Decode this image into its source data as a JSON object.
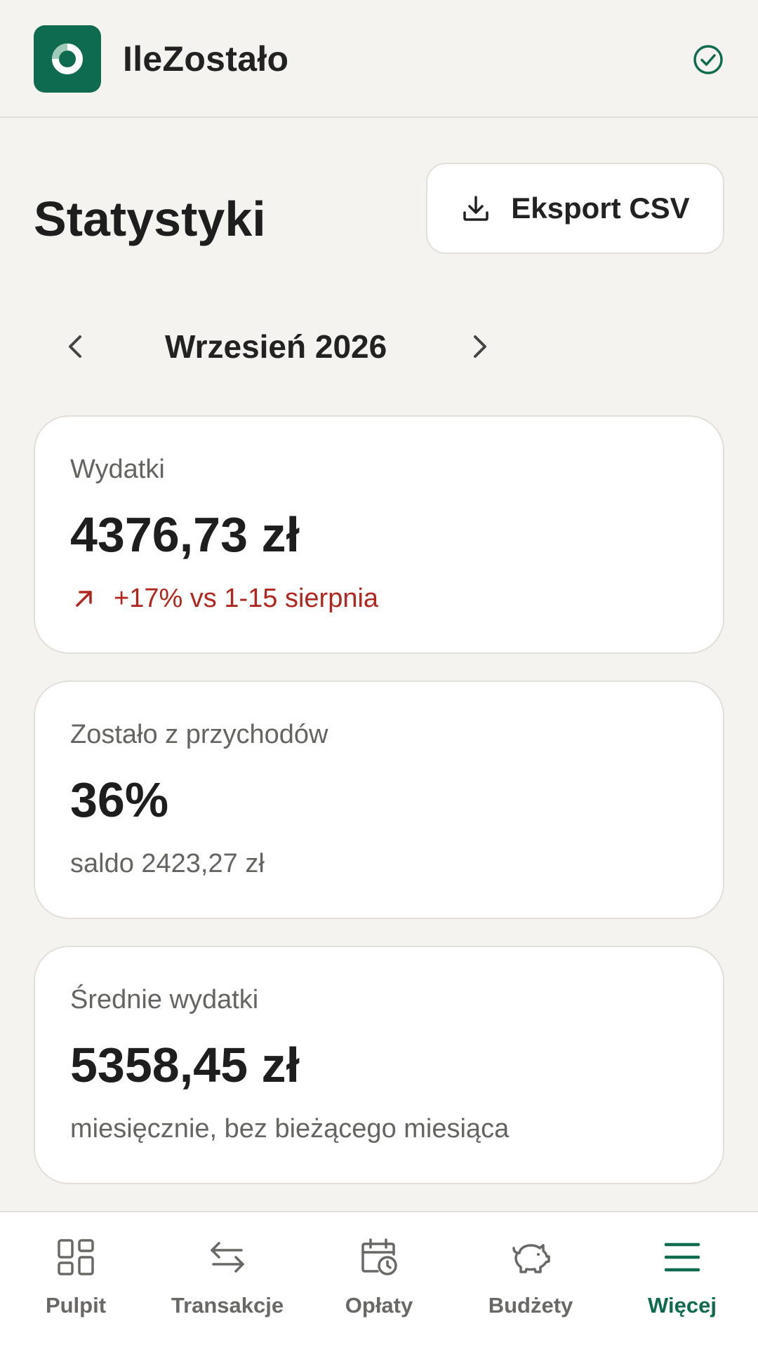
{
  "colors": {
    "background": "#f5f3ef",
    "brand": "#0f6b4f",
    "negative_trend": "#b3261e",
    "muted_text": "#666460"
  },
  "header": {
    "app_name": "IleZostało",
    "logo_icon": "ring-logo-icon",
    "status_icon": "check-circle-icon"
  },
  "page": {
    "title": "Statystyki",
    "export_button": {
      "label": "Eksport CSV",
      "icon": "download-icon"
    }
  },
  "month_nav": {
    "label": "Wrzesień 2026",
    "prev_icon": "chevron-left-icon",
    "next_icon": "chevron-right-icon"
  },
  "cards": [
    {
      "label": "Wydatki",
      "value": "4376,73 zł",
      "trend": "+17% vs 1-15 sierpnia",
      "trend_icon": "arrow-up-right-icon"
    },
    {
      "label": "Zostało z przychodów",
      "value": "36%",
      "sub": "saldo 2423,27 zł"
    },
    {
      "label": "Średnie wydatki",
      "value": "5358,45 zł",
      "sub": "miesięcznie, bez bieżącego miesiąca"
    }
  ],
  "bottom_nav": {
    "items": [
      {
        "label": "Pulpit",
        "icon": "dashboard-icon",
        "active": false
      },
      {
        "label": "Transakcje",
        "icon": "transfer-arrows-icon",
        "active": false
      },
      {
        "label": "Opłaty",
        "icon": "calendar-clock-icon",
        "active": false
      },
      {
        "label": "Budżety",
        "icon": "piggy-bank-icon",
        "active": false
      },
      {
        "label": "Więcej",
        "icon": "menu-icon",
        "active": true
      }
    ]
  }
}
